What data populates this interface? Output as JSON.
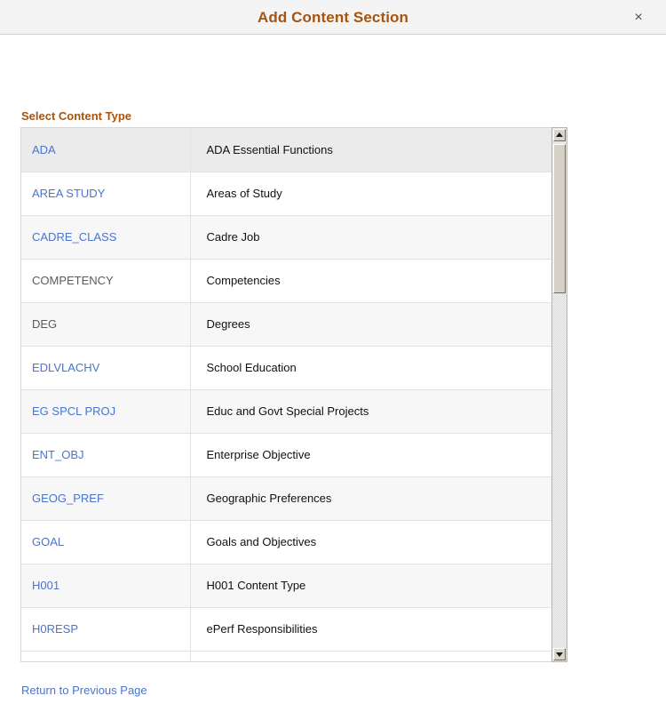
{
  "header": {
    "title": "Add Content Section",
    "close_label": "×",
    "title_color": "#a6540f"
  },
  "section": {
    "label": "Select Content Type"
  },
  "grid": {
    "rows": [
      {
        "code": "ADA",
        "description": "ADA Essential Functions",
        "is_link": true
      },
      {
        "code": "AREA STUDY",
        "description": "Areas of Study",
        "is_link": true
      },
      {
        "code": "CADRE_CLASS",
        "description": "Cadre Job",
        "is_link": true
      },
      {
        "code": "COMPETENCY",
        "description": "Competencies",
        "is_link": false
      },
      {
        "code": "DEG",
        "description": "Degrees",
        "is_link": false
      },
      {
        "code": "EDLVLACHV",
        "description": "School Education",
        "is_link": true
      },
      {
        "code": "EG SPCL PROJ",
        "description": "Educ and Govt Special Projects",
        "is_link": true
      },
      {
        "code": "ENT_OBJ",
        "description": "Enterprise Objective",
        "is_link": true
      },
      {
        "code": "GEOG_PREF",
        "description": "Geographic Preferences",
        "is_link": true
      },
      {
        "code": "GOAL",
        "description": "Goals and Objectives",
        "is_link": true
      },
      {
        "code": "H001",
        "description": "H001 Content Type",
        "is_link": true
      },
      {
        "code": "H0RESP",
        "description": "ePerf Responsibilities",
        "is_link": true
      }
    ]
  },
  "scrollbar": {
    "up_icon": "scroll-up-arrow",
    "down_icon": "scroll-down-arrow"
  },
  "footer": {
    "return_label": "Return to Previous Page",
    "link_color": "#4a74cf"
  }
}
